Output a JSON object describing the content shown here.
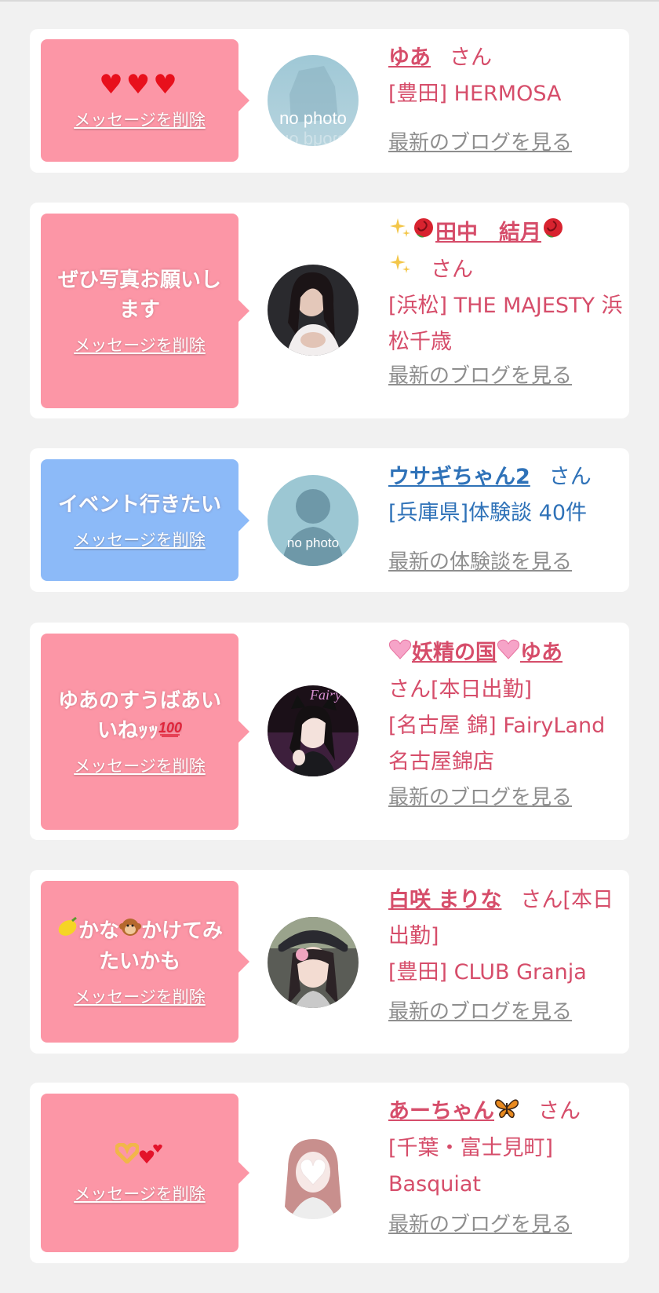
{
  "cards": [
    {
      "message": "♥♥♥",
      "delete_label": "メッセージを削除",
      "name": "ゆあ",
      "san": "さん",
      "shop": "[豊田] HERMOSA",
      "link": "最新のブログを見る",
      "avatar": "no photo"
    },
    {
      "message": "ぜひ写真お願いします",
      "delete_label": "メッセージを削除",
      "name_main": "田中　結月",
      "san": "さん",
      "shop": "[浜松] THE MAJESTY 浜松千歳",
      "link": "最新のブログを見る"
    },
    {
      "message": "イベント行きたい",
      "delete_label": "メッセージを削除",
      "name": "ウサギちゃん2",
      "san": "さん",
      "shop": "[兵庫県]体験談 40件",
      "link": "最新の体験談を見る",
      "avatar": "no photo"
    },
    {
      "message": "ゆあのすうばあいいねｯｯ",
      "delete_label": "メッセージを削除",
      "name_main": "妖精の国",
      "name_tail": "ゆあ",
      "san": "さん[本日出勤]",
      "shop": "[名古屋 錦] FairyLand 名古屋錦店",
      "link": "最新のブログを見る",
      "avatar_text": "Fairy"
    },
    {
      "message_a": "かな",
      "message_b": "かけてみたいかも",
      "delete_label": "メッセージを削除",
      "name": "白咲 まりな",
      "san": "さん[本日出勤]",
      "shop": "[豊田] CLUB Granja",
      "link": "最新のブログを見る"
    },
    {
      "delete_label": "メッセージを削除",
      "name": "あーちゃん",
      "san": "さん",
      "shop": "[千葉・富士見町] Basquiat",
      "link": "最新のブログを見る"
    }
  ],
  "icons": {
    "card1_message": "three-red-hearts-icon",
    "card2_name": "sparkles-and-rose-icons",
    "card4_name": "pink-heart-icon",
    "card4_message": "hundred-points-icon",
    "card5_message": "lemon-and-monkey-icons",
    "card6_name": "butterfly-icon",
    "card6_message": "heart-hands-and-hearts-icon"
  },
  "colors": {
    "pink_bubble": "#fc96a6",
    "blue_bubble": "#8cbaf8",
    "pink_text": "#d64d6a",
    "blue_text": "#2f72b8",
    "gray_link": "#8e8e8e"
  }
}
